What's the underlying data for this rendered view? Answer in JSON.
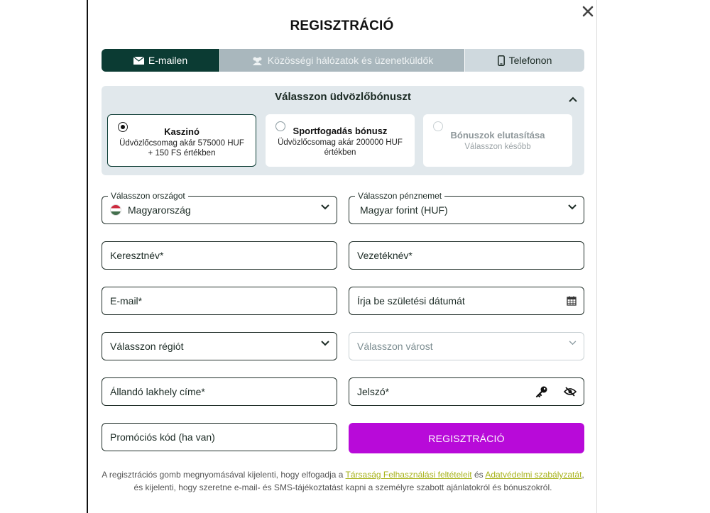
{
  "modal": {
    "title": "REGISZTRÁCIÓ",
    "close_icon": "close-icon"
  },
  "tabs": [
    {
      "label": "E-mailen",
      "icon": "envelope-icon",
      "active": true
    },
    {
      "label": "Közösségi hálózatok és üzenetküldők",
      "icon": "users-icon",
      "active": false
    },
    {
      "label": "Telefonon",
      "icon": "phone-icon",
      "active": false
    }
  ],
  "bonus": {
    "title": "Válasszon üdvözlőbónuszt",
    "cards": [
      {
        "name": "Kaszinó",
        "desc": "Üdvözlőcsomag akár 575000 HUF + 150 FS értékben",
        "selected": true
      },
      {
        "name": "Sportfogadás bónusz",
        "desc": "Üdvözlőcsomag akár 200000 HUF értékben",
        "selected": false
      },
      {
        "name": "Bónuszok elutasítása",
        "desc": "Válasszon később",
        "selected": false
      }
    ]
  },
  "form": {
    "country": {
      "legend": "Válasszon országot",
      "value": "Magyarország"
    },
    "currency": {
      "legend": "Válasszon pénznemet",
      "value": "Magyar forint (HUF)"
    },
    "first_name": {
      "placeholder": "Keresztnév*"
    },
    "last_name": {
      "placeholder": "Vezetéknév*"
    },
    "email": {
      "placeholder": "E-mail*"
    },
    "birthdate": {
      "placeholder": "Írja be születési dátumát"
    },
    "region": {
      "placeholder": "Válasszon régiót"
    },
    "city": {
      "placeholder": "Válasszon várost"
    },
    "address": {
      "placeholder": "Állandó lakhely címe*"
    },
    "password": {
      "placeholder": "Jelszó*"
    },
    "promo": {
      "placeholder": "Promóciós kód (ha van)"
    },
    "submit_label": "REGISZTRÁCIÓ"
  },
  "legal": {
    "part1": "A regisztrációs gomb megnyomásával kijelenti, hogy elfogadja a ",
    "link1": "Társaság Felhasználási feltételeit",
    "part2": " és ",
    "link2": "Adatvédelmi szabályzatát",
    "part3": ", és kijelenti, hogy szeretne e-mail- és SMS-tájékoztatást kapni a személyre szabott ajánlatokról és bónuszokról."
  },
  "colors": {
    "primary_dark": "#0b3b33",
    "register_button": "#b80ad9",
    "link": "#a7b21a",
    "panel": "#e1e8ec"
  }
}
